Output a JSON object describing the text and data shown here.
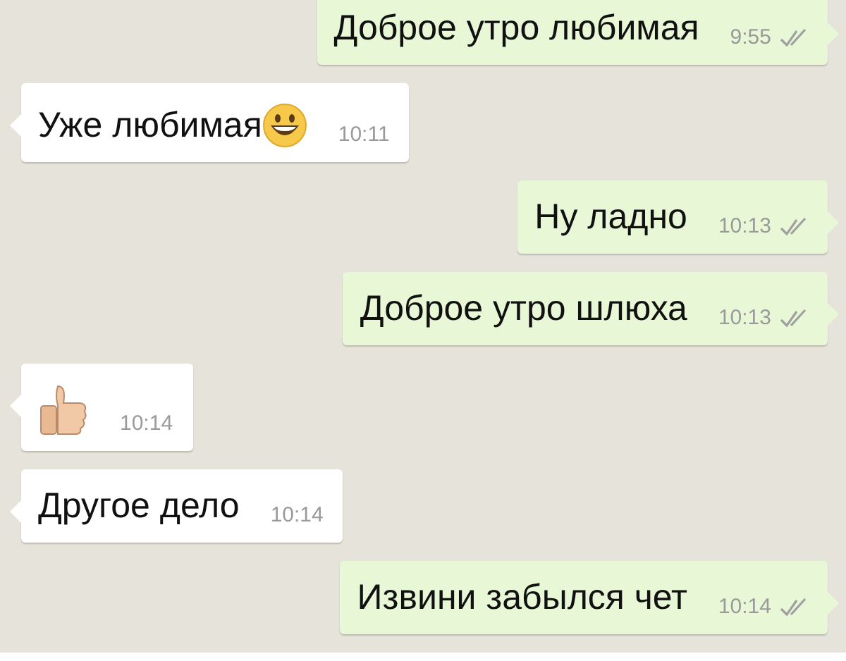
{
  "messages": [
    {
      "outgoing": true,
      "kind": "text",
      "text": "Доброе утро любимая",
      "time": "9:55",
      "delivered": true
    },
    {
      "outgoing": false,
      "kind": "mixed",
      "text": "Уже любимая",
      "time": "10:11"
    },
    {
      "outgoing": true,
      "kind": "text",
      "text": "Ну ладно",
      "time": "10:13",
      "delivered": true
    },
    {
      "outgoing": true,
      "kind": "text",
      "text": "Доброе утро шлюха",
      "time": "10:13",
      "delivered": true
    },
    {
      "outgoing": false,
      "kind": "icon",
      "time": "10:14"
    },
    {
      "outgoing": false,
      "kind": "text",
      "text": "Другое дело",
      "time": "10:14"
    },
    {
      "outgoing": true,
      "kind": "text",
      "text": "Извини забылся чет",
      "time": "10:14",
      "delivered": true
    }
  ]
}
